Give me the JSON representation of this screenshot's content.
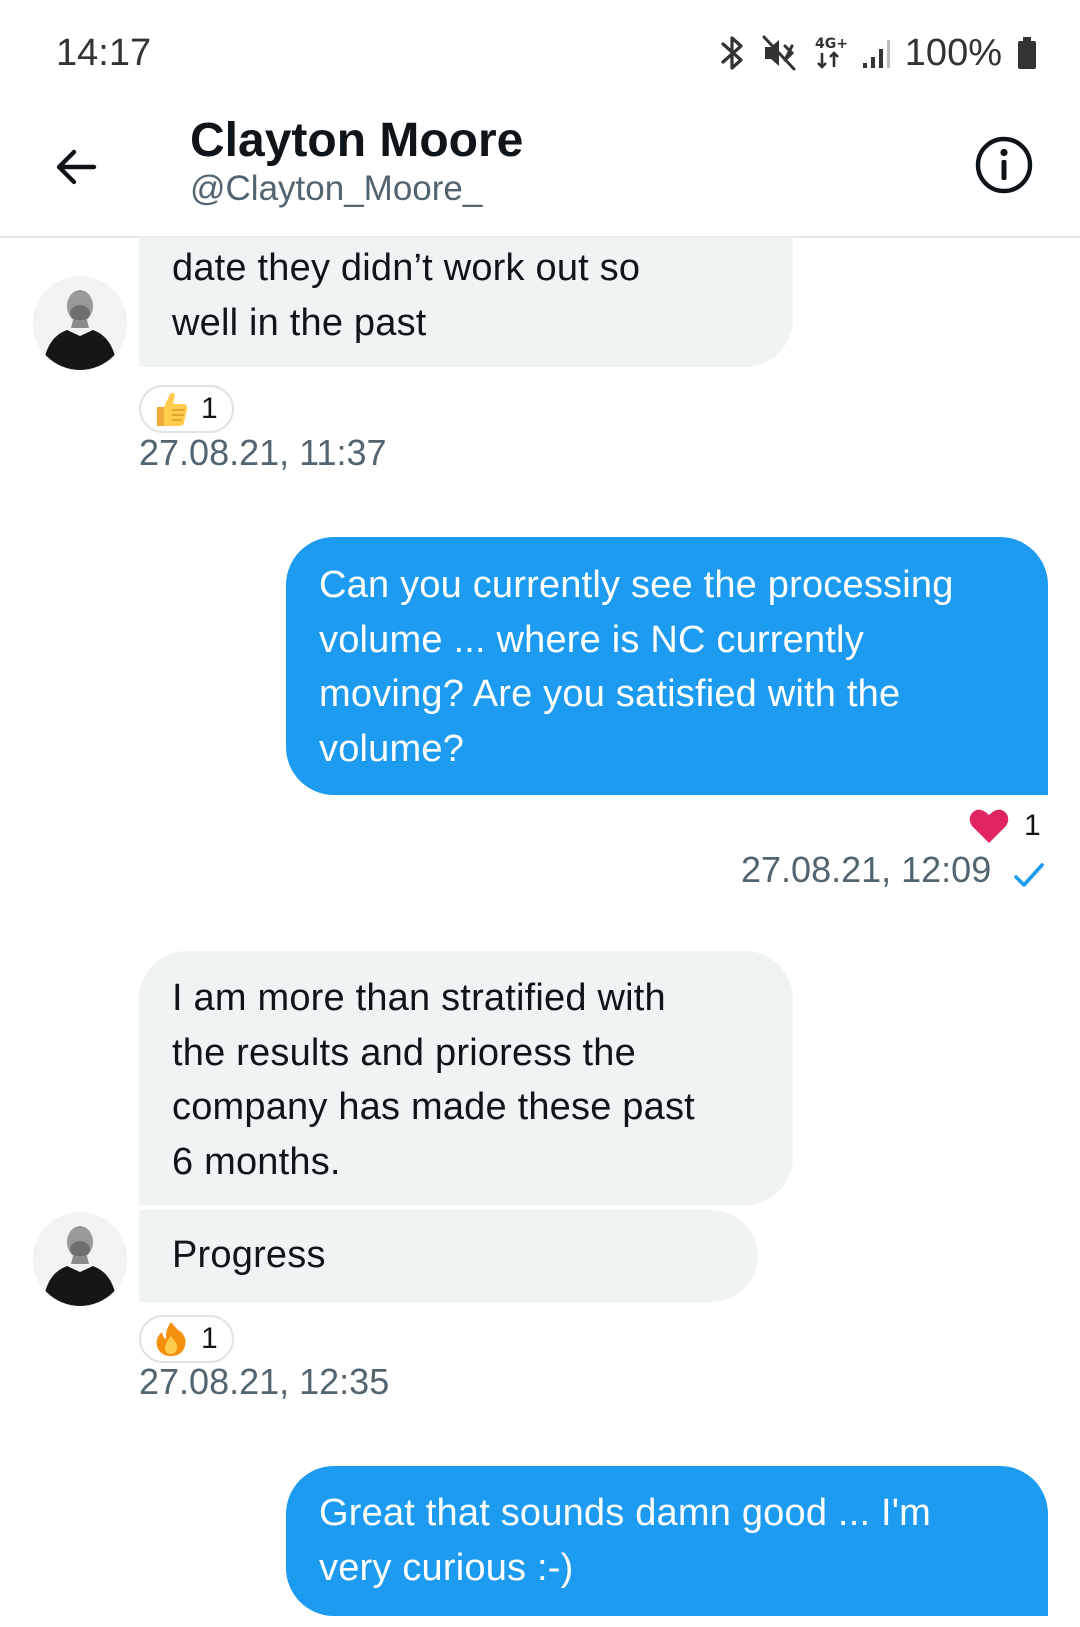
{
  "status_bar": {
    "time": "14:17",
    "battery": "100%"
  },
  "header": {
    "name": "Clayton Moore",
    "handle": "@Clayton_Moore_"
  },
  "messages": [
    {
      "direction": "in",
      "lines": [
        "date they didn’t work out so",
        "well in the past"
      ],
      "reaction": {
        "icon": "thumbs-up-icon",
        "count": "1"
      },
      "timestamp": "27.08.21, 11:37"
    },
    {
      "direction": "out",
      "lines": [
        "Can you currently see the processing",
        "volume ... where is NC currently",
        "moving? Are you satisfied with the",
        "volume?"
      ],
      "reaction": {
        "icon": "heart-icon",
        "count": "1"
      },
      "timestamp": "27.08.21, 12:09",
      "read_receipt": "check-icon"
    },
    {
      "direction": "in",
      "lines": [
        "I am more than stratified with",
        "the results and prioress the",
        "company has made these past",
        "6 months."
      ]
    },
    {
      "direction": "in",
      "lines": [
        "Progress"
      ],
      "reaction": {
        "icon": "fire-icon",
        "count": "1"
      },
      "timestamp": "27.08.21, 12:35"
    },
    {
      "direction": "out",
      "lines": [
        "Great that sounds damn good ... I'm",
        "very curious :-)"
      ]
    }
  ],
  "colors": {
    "outgoing_bubble": "#1d9bf0",
    "incoming_bubble": "#eff3f4",
    "heart": "#e0245e",
    "check": "#1d9bf0"
  }
}
